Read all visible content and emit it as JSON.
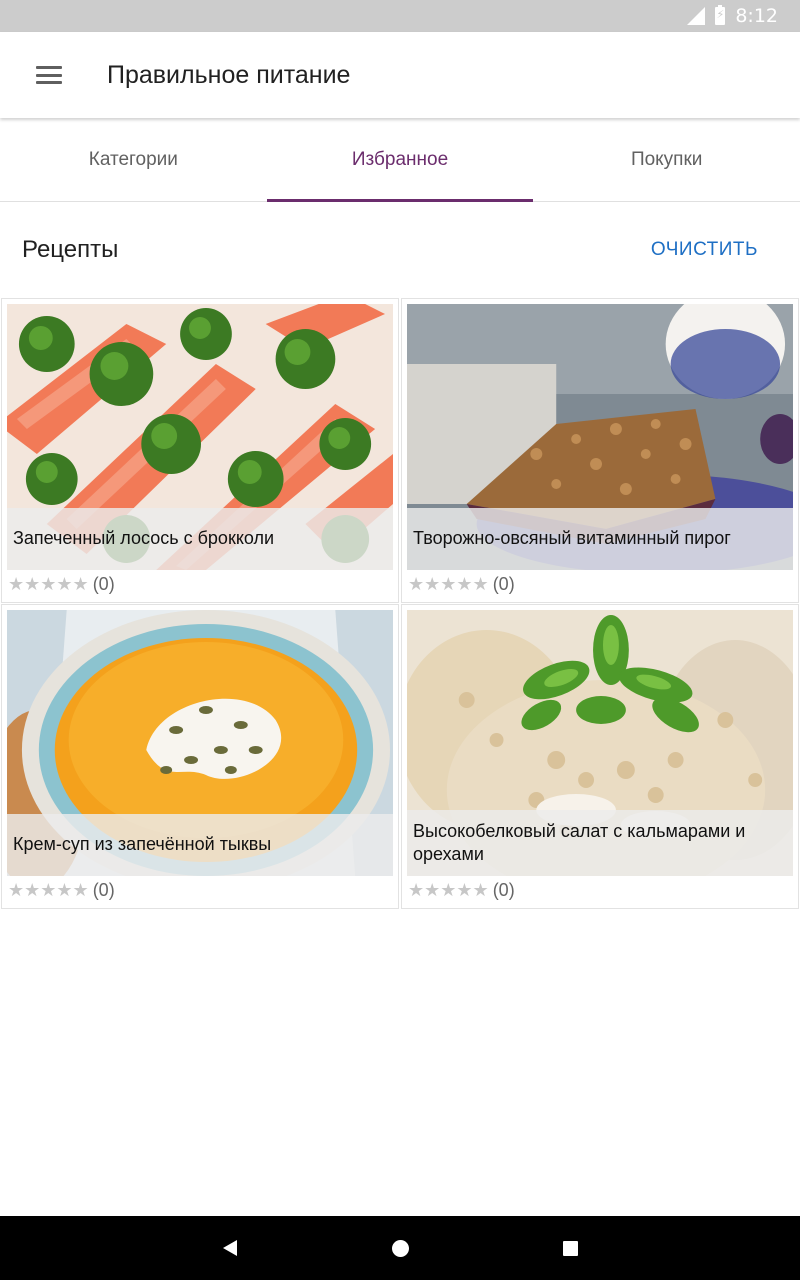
{
  "status_bar": {
    "time": "8:12",
    "icons": [
      "signal-off-icon",
      "battery-charging-icon"
    ]
  },
  "app_bar": {
    "title": "Правильное питание",
    "menu_icon": "menu-icon"
  },
  "tabs": [
    {
      "label": "Категории",
      "active": false
    },
    {
      "label": "Избранное",
      "active": true
    },
    {
      "label": "Покупки",
      "active": false
    }
  ],
  "accent_color": "#6b2d6d",
  "link_color": "#1e6fc4",
  "section": {
    "title": "Рецепты",
    "clear_label": "ОЧИСТИТЬ"
  },
  "recipes": [
    {
      "title": "Запеченный лосось с брокколи",
      "stars": "★★★★★",
      "rating_count": "(0)",
      "image": "salmon-broccoli-photo"
    },
    {
      "title": "Творожно-овсяный витаминный пирог",
      "stars": "★★★★★",
      "rating_count": "(0)",
      "image": "oat-pie-photo"
    },
    {
      "title": "Крем-суп из запечённой тыквы",
      "stars": "★★★★★",
      "rating_count": "(0)",
      "image": "pumpkin-soup-photo"
    },
    {
      "title": "Высокобелковый салат с кальмарами и орехами",
      "stars": "★★★★★",
      "rating_count": "(0)",
      "image": "squid-salad-photo"
    }
  ],
  "nav_bar": {
    "icons": [
      "back-icon",
      "home-icon",
      "recents-icon"
    ]
  }
}
